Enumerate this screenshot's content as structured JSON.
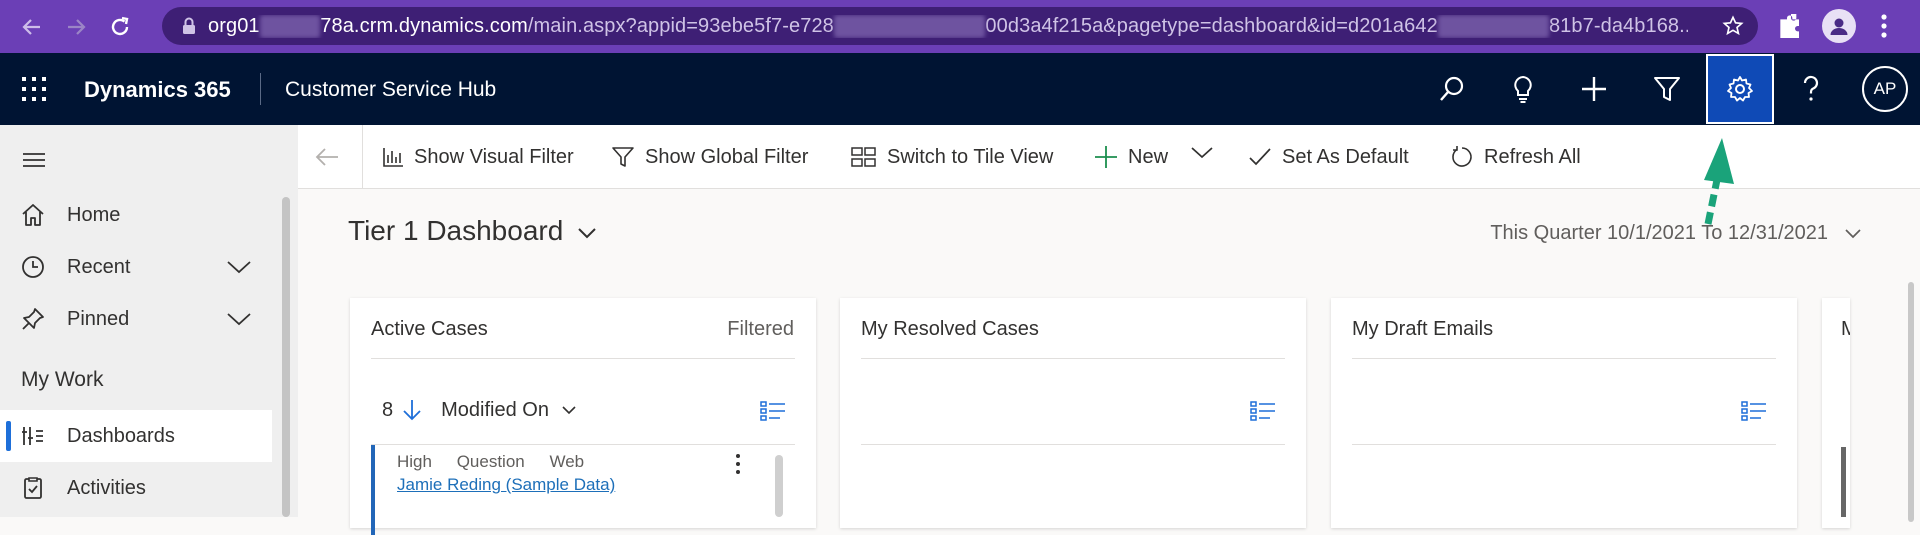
{
  "browser": {
    "url_host_start": "org01",
    "url_host_blur": "xxxxxx",
    "url_host_end": "78a.crm.dynamics.com",
    "url_path_1": "/main.aspx?appid=93ebe5f7-e728",
    "url_path_blur_1": "xxxxxxxxxxxxxxx",
    "url_path_2": "00d3a4f215a&pagetype=dashboard&id=d201a642",
    "url_path_blur_2": "xxxxxxxxxxx",
    "url_path_3": "81b7-da4b168..."
  },
  "header": {
    "brand": "Dynamics 365",
    "app_name": "Customer Service Hub",
    "avatar_initials": "AP",
    "settings_highlight_color": "#0f4ab6"
  },
  "sidebar": {
    "items": [
      {
        "label": "Home",
        "icon": "home-icon"
      },
      {
        "label": "Recent",
        "icon": "clock-icon"
      },
      {
        "label": "Pinned",
        "icon": "pin-icon"
      }
    ],
    "section_title": "My Work",
    "work_items": [
      {
        "label": "Dashboards",
        "icon": "dashboard-icon",
        "selected": true
      },
      {
        "label": "Activities",
        "icon": "activities-icon"
      }
    ]
  },
  "commandbar": {
    "show_visual_filter": "Show Visual Filter",
    "show_global_filter": "Show Global Filter",
    "switch_tile_view": "Switch to Tile View",
    "new": "New",
    "set_as_default": "Set As Default",
    "refresh_all": "Refresh All"
  },
  "dashboard": {
    "title": "Tier 1 Dashboard",
    "period": "This Quarter 10/1/2021 To 12/31/2021",
    "cards": [
      {
        "title": "Active Cases",
        "status": "Filtered",
        "count": "8",
        "sort_field": "Modified On",
        "record": {
          "priority": "High",
          "type": "Question",
          "origin": "Web",
          "customer": "Jamie Reding (Sample Data)"
        }
      },
      {
        "title": "My Resolved Cases"
      },
      {
        "title": "My Draft Emails"
      },
      {
        "title": "M"
      }
    ]
  },
  "annotation": {
    "arrow_color": "#1aa37a"
  }
}
